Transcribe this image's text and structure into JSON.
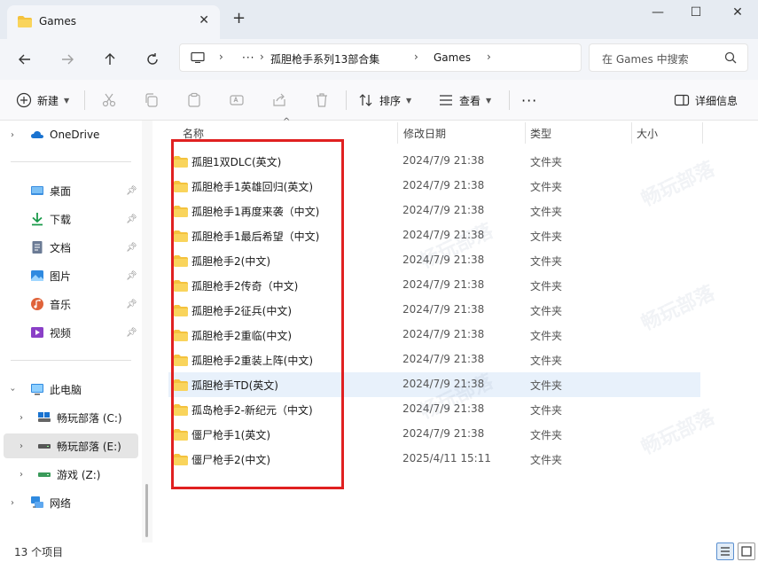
{
  "window": {
    "tab_title": "Games",
    "new_tab": "+",
    "tab_close": "✕",
    "minimize": "—",
    "maximize": "☐",
    "close": "✕"
  },
  "address": {
    "more": "···",
    "segments": [
      "孤胆枪手系列13部合集",
      "Games"
    ],
    "search_placeholder": "在 Games 中搜索"
  },
  "toolbar": {
    "new_label": "新建",
    "sort_label": "排序",
    "view_label": "查看",
    "more": "···",
    "details_label": "详细信息"
  },
  "sidebar": {
    "items": [
      {
        "label": "OneDrive"
      },
      {
        "label": "桌面"
      },
      {
        "label": "下载"
      },
      {
        "label": "文档"
      },
      {
        "label": "图片"
      },
      {
        "label": "音乐"
      },
      {
        "label": "视频"
      },
      {
        "label": "此电脑"
      },
      {
        "label": "畅玩部落 (C:)"
      },
      {
        "label": "畅玩部落 (E:)"
      },
      {
        "label": "游戏 (Z:)"
      },
      {
        "label": "网络"
      }
    ]
  },
  "columns": {
    "name": "名称",
    "date": "修改日期",
    "type": "类型",
    "size": "大小"
  },
  "files": [
    {
      "name": "孤胆1双DLC(英文)",
      "date": "2024/7/9 21:38",
      "type": "文件夹"
    },
    {
      "name": "孤胆枪手1英雄回归(英文)",
      "date": "2024/7/9 21:38",
      "type": "文件夹"
    },
    {
      "name": "孤胆枪手1再度来袭（中文)",
      "date": "2024/7/9 21:38",
      "type": "文件夹"
    },
    {
      "name": "孤胆枪手1最后希望（中文)",
      "date": "2024/7/9 21:38",
      "type": "文件夹"
    },
    {
      "name": "孤胆枪手2(中文)",
      "date": "2024/7/9 21:38",
      "type": "文件夹"
    },
    {
      "name": "孤胆枪手2传奇（中文)",
      "date": "2024/7/9 21:38",
      "type": "文件夹"
    },
    {
      "name": "孤胆枪手2征兵(中文)",
      "date": "2024/7/9 21:38",
      "type": "文件夹"
    },
    {
      "name": "孤胆枪手2重临(中文)",
      "date": "2024/7/9 21:38",
      "type": "文件夹"
    },
    {
      "name": "孤胆枪手2重装上阵(中文)",
      "date": "2024/7/9 21:38",
      "type": "文件夹"
    },
    {
      "name": "孤胆枪手TD(英文)",
      "date": "2024/7/9 21:38",
      "type": "文件夹"
    },
    {
      "name": "孤岛枪手2-新纪元（中文)",
      "date": "2024/7/9 21:38",
      "type": "文件夹"
    },
    {
      "name": "僵尸枪手1(英文)",
      "date": "2024/7/9 21:38",
      "type": "文件夹"
    },
    {
      "name": "僵尸枪手2(中文)",
      "date": "2025/4/11 15:11",
      "type": "文件夹"
    }
  ],
  "status": {
    "count": "13 个项目"
  },
  "colors": {
    "folder": "#f4c23d",
    "highlight": "#e8f1fb",
    "annotation": "#e02020"
  }
}
